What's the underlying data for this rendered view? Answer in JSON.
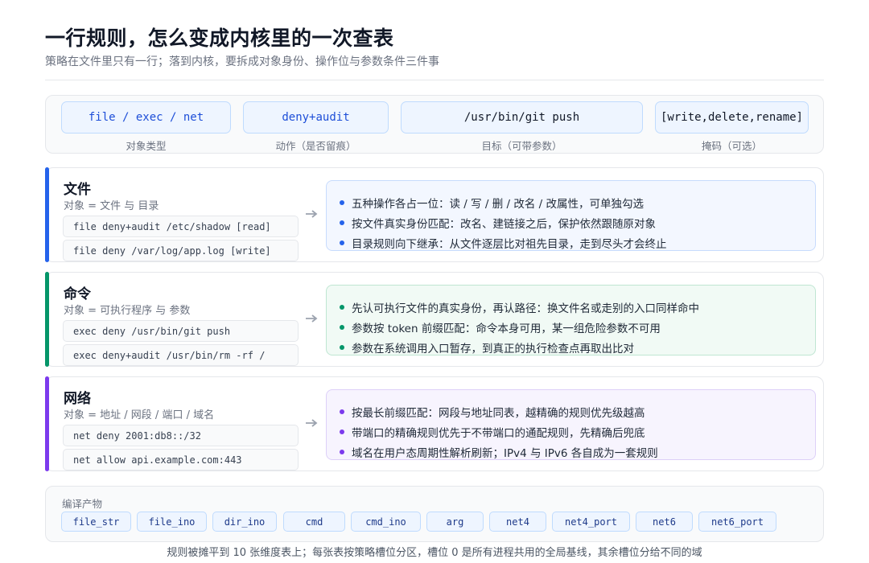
{
  "header": {
    "title": "一行规则，怎么变成内核里的一次查表",
    "subtitle": "策略在文件里只有一行；落到内核，要拆成对象身份、操作位与参数条件三件事"
  },
  "syntax": {
    "tokens": [
      {
        "text": "file / exec / net",
        "label": "对象类型"
      },
      {
        "text": "deny+audit",
        "label": "动作（是否留痕）"
      },
      {
        "text": "/usr/bin/git push",
        "label": "目标（可带参数）"
      },
      {
        "text": "[write,delete,rename]",
        "label": "掩码（可选）"
      }
    ]
  },
  "sections": [
    {
      "title": "文件",
      "subtitle": "对象 = 文件 与 目录",
      "color": "#2563eb",
      "examples": [
        "file deny+audit /etc/shadow [read]",
        "file deny /var/log/app.log [write]"
      ],
      "bullets": [
        "五种操作各占一位：读 / 写 / 删 / 改名 / 改属性，可单独勾选",
        "按文件真实身份匹配：改名、建链接之后，保护依然跟随原对象",
        "目录规则向下继承：从文件逐层比对祖先目录，走到尽头才会终止"
      ]
    },
    {
      "title": "命令",
      "subtitle": "对象 = 可执行程序 与 参数",
      "color": "#059669",
      "examples": [
        "exec deny /usr/bin/git push",
        "exec deny+audit /usr/bin/rm -rf /"
      ],
      "bullets": [
        "先认可执行文件的真实身份，再认路径：换文件名或走别的入口同样命中",
        "参数按 token 前缀匹配：命令本身可用，某一组危险参数不可用",
        "参数在系统调用入口暂存，到真正的执行检查点再取出比对"
      ]
    },
    {
      "title": "网络",
      "subtitle": "对象 = 地址 / 网段 / 端口 / 域名",
      "color": "#7c3aed",
      "examples": [
        "net deny 2001:db8::/32",
        "net allow api.example.com:443"
      ],
      "bullets": [
        "按最长前缀匹配：网段与地址同表，越精确的规则优先级越高",
        "带端口的精确规则优先于不带端口的通配规则，先精确后兜底",
        "域名在用户态周期性解析刷新；IPv4 与 IPv6 各自成为一套规则"
      ]
    }
  ],
  "output": {
    "label": "编译产物",
    "chips": [
      "file_str",
      "file_ino",
      "dir_ino",
      "cmd",
      "cmd_ino",
      "arg",
      "net4",
      "net4_port",
      "net6",
      "net6_port"
    ]
  },
  "footer": "规则被摊平到 10 张维度表上；每张表按策略槽位分区，槽位 0 是所有进程共用的全局基线，其余槽位分给不同的域"
}
